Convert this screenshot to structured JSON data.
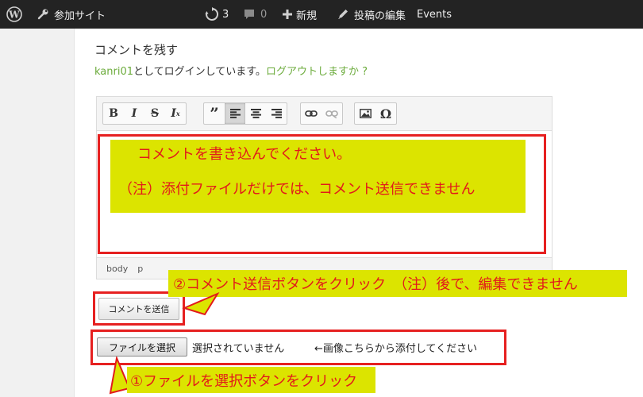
{
  "adminbar": {
    "site_name": "参加サイト",
    "updates_count": "3",
    "comments_count": "0",
    "new_label": "新規",
    "edit_label": "投稿の編集",
    "events_label": "Events"
  },
  "reply": {
    "title": "コメントを残す",
    "username": "kanri01",
    "logged_in_text": "としてログインしています。",
    "logout_link": "ログアウトしますか ?"
  },
  "editor": {
    "status_path": [
      "body",
      "p"
    ],
    "toolbar_icons": [
      "bold-icon",
      "italic-icon",
      "strikethrough-icon",
      "clear-formatting-icon",
      "blockquote-icon",
      "align-left-icon",
      "align-center-icon",
      "align-right-icon",
      "link-icon",
      "unlink-icon",
      "image-icon",
      "special-character-icon"
    ]
  },
  "annotations": {
    "editor_line1": "コメントを書き込んでください。",
    "editor_line2": "（注）添付ファイルだけでは、コメント送信できません",
    "submit_note": "②コメント送信ボタンをクリック　（注）後で、編集できません",
    "file_note": "①ファイルを選択ボタンをクリック"
  },
  "form": {
    "submit_label": "コメントを送信",
    "file_button_label": "ファイルを選択",
    "file_status": "選択されていません",
    "file_hint": "←画像こちらから添付してください"
  },
  "colors": {
    "adminbar_bg": "#232323",
    "link_green": "#6bab3b",
    "annotation_red": "#e62020",
    "annotation_yellow": "#dce400"
  }
}
